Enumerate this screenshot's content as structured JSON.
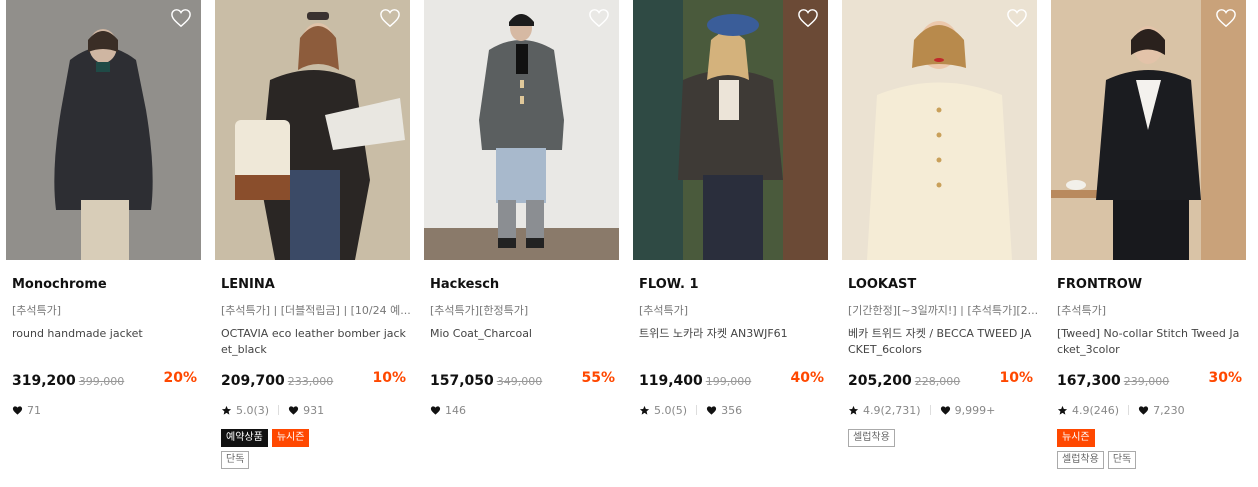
{
  "products": [
    {
      "brand": "Monochrome",
      "promo": "[추석특가]",
      "name": "round handmade jacket",
      "price": "319,200",
      "original_price": "399,000",
      "discount": "20%",
      "rating": "",
      "likes": "71",
      "badges": [],
      "tags": []
    },
    {
      "brand": "LENINA",
      "promo": "[추석특가] | [더블적립금] | [10/24 예...",
      "name": "OCTAVIA eco leather bomber jacket_black",
      "price": "209,700",
      "original_price": "233,000",
      "discount": "10%",
      "rating": "5.0(3)",
      "likes": "931",
      "badges": [
        {
          "label": "예약상품",
          "color": "black"
        },
        {
          "label": "뉴시즌",
          "color": "orange"
        }
      ],
      "tags": [
        "단독"
      ]
    },
    {
      "brand": "Hackesch",
      "promo": "[추석특가][한정특가]",
      "name": "Mio Coat_Charcoal",
      "price": "157,050",
      "original_price": "349,000",
      "discount": "55%",
      "rating": "",
      "likes": "146",
      "badges": [],
      "tags": []
    },
    {
      "brand": "FLOW. 1",
      "promo": "[추석특가]",
      "name": "트위드 노카라 자켓 AN3WJF61",
      "price": "119,400",
      "original_price": "199,000",
      "discount": "40%",
      "rating": "5.0(5)",
      "likes": "356",
      "badges": [],
      "tags": []
    },
    {
      "brand": "LOOKAST",
      "promo": "[기간한정][~3일까지!] | [추석특가][2...",
      "name": "베카 트위드 자켓 / BECCA TWEED JACKET_6colors",
      "price": "205,200",
      "original_price": "228,000",
      "discount": "10%",
      "rating": "4.9(2,731)",
      "likes": "9,999+",
      "badges": [],
      "tags": [
        "셀럽착용"
      ]
    },
    {
      "brand": "FRONTROW",
      "promo": "[추석특가]",
      "name": "[Tweed] No-collar Stitch Tweed Jacket_3color",
      "price": "167,300",
      "original_price": "239,000",
      "discount": "30%",
      "rating": "4.9(246)",
      "likes": "7,230",
      "badges": [
        {
          "label": "뉴시즌",
          "color": "orange"
        }
      ],
      "tags": [
        "셀럽착용",
        "단독"
      ]
    }
  ],
  "icons": {
    "wishlist": "heart-outline-icon",
    "rating": "star-icon",
    "likes": "heart-filled-icon"
  },
  "colors": {
    "discount": "#ff4800",
    "badge_black": "#111111",
    "badge_orange": "#ff4800"
  }
}
